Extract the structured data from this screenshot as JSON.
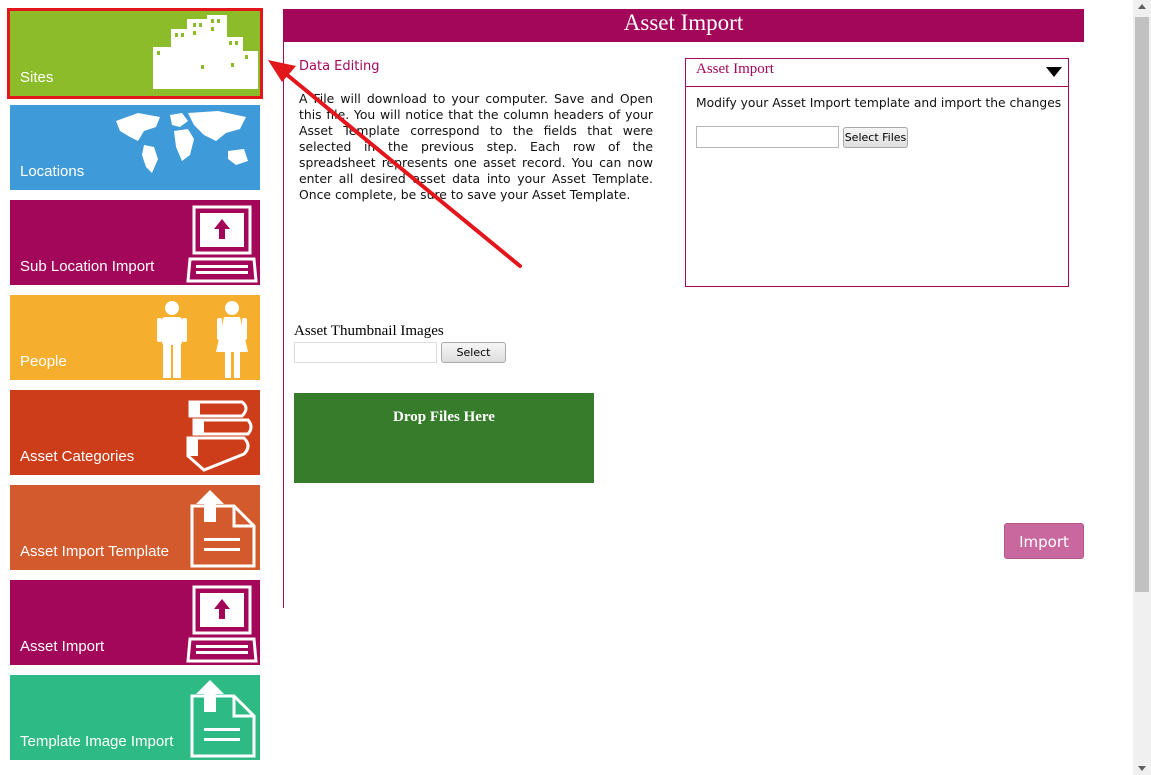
{
  "sidebar": {
    "items": [
      {
        "label": "Sites",
        "color": "#8cbc2a",
        "icon": "buildings-icon"
      },
      {
        "label": "Locations",
        "color": "#3e9ad9",
        "icon": "world-map-icon"
      },
      {
        "label": "Sub Location Import",
        "color": "#a3075a",
        "icon": "computer-upload-icon"
      },
      {
        "label": "People",
        "color": "#f5ae2d",
        "icon": "people-icon"
      },
      {
        "label": "Asset Categories",
        "color": "#cd3d19",
        "icon": "books-icon"
      },
      {
        "label": "Asset Import Template",
        "color": "#d35a2c",
        "icon": "document-upload-icon"
      },
      {
        "label": "Asset Import",
        "color": "#a3075a",
        "icon": "computer-upload-icon"
      },
      {
        "label": "Template Image Import",
        "color": "#2dba84",
        "icon": "document-upload-icon"
      }
    ]
  },
  "main": {
    "title": "Asset Import",
    "data_editing": {
      "title": "Data Editing",
      "text": "A File will download to your computer. Save and Open this file. You will notice that the column headers of your Asset Template correspond to the fields that were selected in the previous step. Each row of the spreadsheet represents one asset record. You can now enter all desired asset data into your Asset Template. Once complete, be sure to save your Asset Template."
    },
    "accordion": {
      "header": "Asset Import",
      "description": "Modify your Asset Import template and import the changes",
      "select_files_label": "Select Files"
    },
    "thumbnails": {
      "label": "Asset Thumbnail Images",
      "select_label": "Select"
    },
    "drop_zone_label": "Drop Files Here",
    "import_label": "Import"
  },
  "colors": {
    "brand": "#a3075a",
    "drop_zone": "#367c2b",
    "import_button": "#c8689f",
    "annotation": "#e3161c"
  }
}
